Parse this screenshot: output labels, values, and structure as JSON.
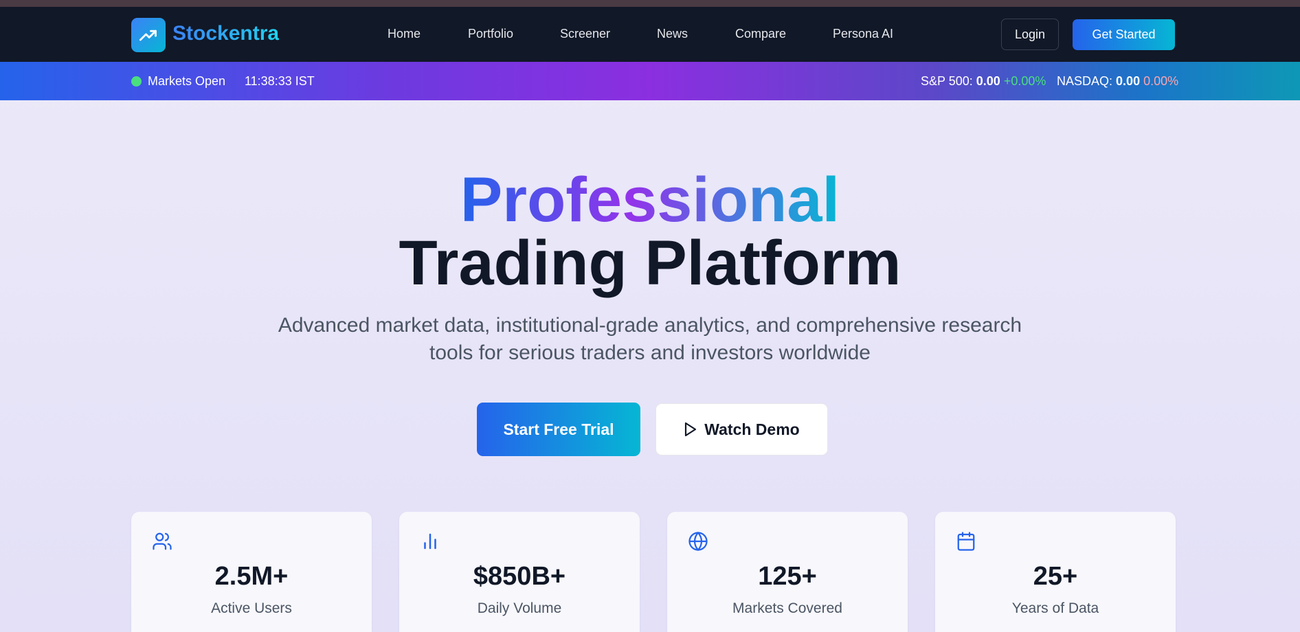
{
  "colors": {
    "navbar_bg": "#111827",
    "accent_blue": "#2563eb",
    "accent_cyan": "#06b6d4",
    "accent_purple": "#9333ea",
    "positive": "#4ade80",
    "negative": "#fda4af"
  },
  "header": {
    "brand": "Stockentra",
    "logo_icon": "trending-up-icon",
    "nav": [
      "Home",
      "Portfolio",
      "Screener",
      "News",
      "Compare",
      "Persona AI"
    ],
    "login_label": "Login",
    "cta_label": "Get Started"
  },
  "ticker": {
    "status": "Markets Open",
    "time": "11:38:33 IST",
    "indices": [
      {
        "name": "S&P 500:",
        "value": "0.00",
        "change": "+0.00%"
      },
      {
        "name": "NASDAQ:",
        "value": "0.00",
        "change": "0.00%"
      }
    ]
  },
  "hero": {
    "title_gradient": "Professional",
    "title_main": "Trading Platform",
    "subtitle_line1": "Advanced market data, institutional-grade analytics, and comprehensive research",
    "subtitle_line2": "tools for serious traders and investors worldwide",
    "primary_button": "Start Free Trial",
    "secondary_button": "Watch Demo"
  },
  "stats": [
    {
      "icon": "users-icon",
      "value": "2.5M+",
      "label": "Active Users"
    },
    {
      "icon": "bar-chart-icon",
      "value": "$850B+",
      "label": "Daily Volume"
    },
    {
      "icon": "globe-icon",
      "value": "125+",
      "label": "Markets Covered"
    },
    {
      "icon": "calendar-icon",
      "value": "25+",
      "label": "Years of Data"
    }
  ]
}
